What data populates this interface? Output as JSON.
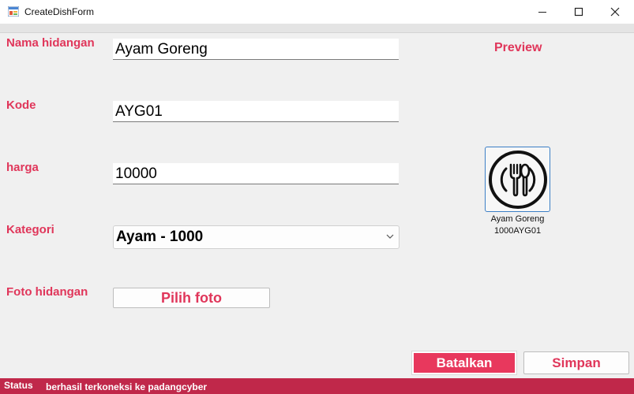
{
  "window": {
    "title": "CreateDishForm",
    "controls": [
      "minimize-icon",
      "maximize-icon",
      "close-icon"
    ]
  },
  "form": {
    "name_label": "Nama hidangan",
    "name_value": "Ayam Goreng",
    "code_label": "Kode",
    "code_value": "AYG01",
    "price_label": "harga",
    "price_value": "10000",
    "category_label": "Kategori",
    "category_selected": "Ayam - 1000",
    "photo_label": "Foto hidangan",
    "photo_button": "Pilih foto"
  },
  "preview": {
    "title": "Preview",
    "icon": "plate-fork-spoon-icon",
    "name": "Ayam Goreng",
    "subtitle": "1000AYG01"
  },
  "actions": {
    "cancel": "Batalkan",
    "save": "Simpan"
  },
  "status": {
    "label": "Status",
    "message": "berhasil terkoneksi ke padangcyber"
  },
  "colors": {
    "accent": "#e0365a",
    "status_bar": "#c0284a",
    "cancel_bg": "#e8385d",
    "window_bg": "#f0f0f0"
  }
}
